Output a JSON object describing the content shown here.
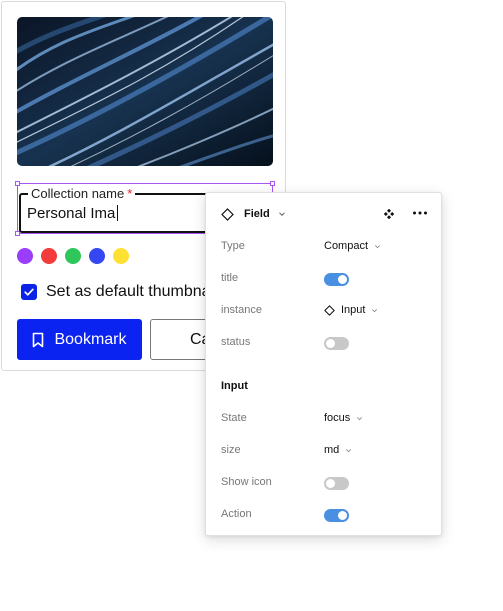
{
  "card": {
    "field": {
      "label": "Collection name",
      "required_mark": "*",
      "value": "Personal Ima"
    },
    "swatches": [
      "#9b3dfc",
      "#f43b3b",
      "#2fc65a",
      "#3547f0",
      "#ffe033"
    ],
    "checkbox": {
      "label": "Set as default thumbnail",
      "checked": true
    },
    "primary_button": {
      "label": "Bookmark",
      "icon": "bookmark-icon"
    },
    "secondary_button": {
      "label": "Cancel"
    }
  },
  "panel": {
    "header": {
      "title": "Field",
      "icon": "component-instance-icon"
    },
    "props": [
      {
        "name": "Type",
        "value": "Compact"
      },
      {
        "name": "title",
        "toggle": true
      },
      {
        "name": "instance",
        "value": "Input"
      },
      {
        "name": "status",
        "toggle": false
      }
    ],
    "section": "Input",
    "input_props": [
      {
        "name": "State",
        "value": "focus"
      },
      {
        "name": "size",
        "value": "md"
      },
      {
        "name": "Show icon",
        "toggle": false
      },
      {
        "name": "Action",
        "toggle": true
      }
    ]
  },
  "colors": {
    "primary": "#0a23f0",
    "selection": "#a855f7",
    "toggle_on": "#4a90e2",
    "toggle_off": "#c8c8c8"
  }
}
